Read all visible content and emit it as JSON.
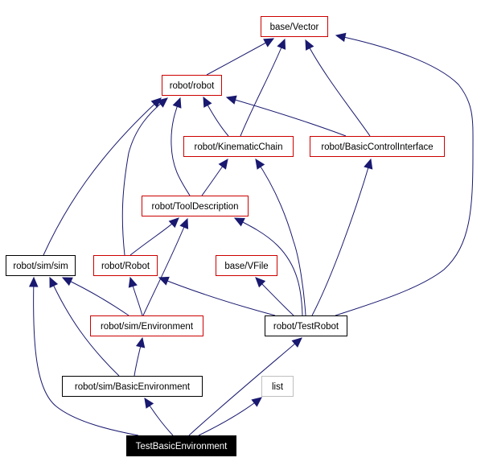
{
  "diagram": {
    "type": "inheritance-graph",
    "colors": {
      "edge": "#191970",
      "documented_border": "#cc0000",
      "undocumented_border": "#000000",
      "external_border": "#bfbfbf",
      "root_fill": "#000000",
      "root_text": "#ffffff",
      "text": "#000000",
      "background": "#ffffff"
    },
    "nodes": [
      {
        "id": "vector",
        "label": "base/Vector",
        "style": "documented"
      },
      {
        "id": "robot_robot",
        "label": "robot/robot",
        "style": "documented"
      },
      {
        "id": "kinematic",
        "label": "robot/KinematicChain",
        "style": "documented"
      },
      {
        "id": "bci",
        "label": "robot/BasicControlInterface",
        "style": "documented"
      },
      {
        "id": "tooldesc",
        "label": "robot/ToolDescription",
        "style": "documented"
      },
      {
        "id": "simsim",
        "label": "robot/sim/sim",
        "style": "undocumented"
      },
      {
        "id": "robot_Robot",
        "label": "robot/Robot",
        "style": "documented"
      },
      {
        "id": "vfile",
        "label": "base/VFile",
        "style": "documented"
      },
      {
        "id": "environment",
        "label": "robot/sim/Environment",
        "style": "documented"
      },
      {
        "id": "testrobot",
        "label": "robot/TestRobot",
        "style": "undocumented"
      },
      {
        "id": "basicenv",
        "label": "robot/sim/BasicEnvironment",
        "style": "undocumented"
      },
      {
        "id": "list",
        "label": "list",
        "style": "external"
      },
      {
        "id": "root",
        "label": "TestBasicEnvironment",
        "style": "root"
      }
    ],
    "edges": [
      {
        "from": "robot_robot",
        "to": "vector"
      },
      {
        "from": "kinematic",
        "to": "vector"
      },
      {
        "from": "bci",
        "to": "vector"
      },
      {
        "from": "testrobot",
        "to": "vector"
      },
      {
        "from": "kinematic",
        "to": "robot_robot"
      },
      {
        "from": "bci",
        "to": "robot_robot"
      },
      {
        "from": "tooldesc",
        "to": "robot_robot"
      },
      {
        "from": "simsim",
        "to": "robot_robot"
      },
      {
        "from": "robot_Robot",
        "to": "robot_robot"
      },
      {
        "from": "tooldesc",
        "to": "kinematic"
      },
      {
        "from": "testrobot",
        "to": "kinematic"
      },
      {
        "from": "testrobot",
        "to": "bci"
      },
      {
        "from": "robot_Robot",
        "to": "tooldesc"
      },
      {
        "from": "environment",
        "to": "tooldesc"
      },
      {
        "from": "testrobot",
        "to": "tooldesc"
      },
      {
        "from": "environment",
        "to": "simsim"
      },
      {
        "from": "basicenv",
        "to": "simsim"
      },
      {
        "from": "root",
        "to": "simsim"
      },
      {
        "from": "environment",
        "to": "robot_Robot"
      },
      {
        "from": "testrobot",
        "to": "robot_Robot"
      },
      {
        "from": "testrobot",
        "to": "vfile"
      },
      {
        "from": "basicenv",
        "to": "environment"
      },
      {
        "from": "root",
        "to": "basicenv"
      },
      {
        "from": "root",
        "to": "testrobot"
      },
      {
        "from": "root",
        "to": "list"
      }
    ]
  }
}
